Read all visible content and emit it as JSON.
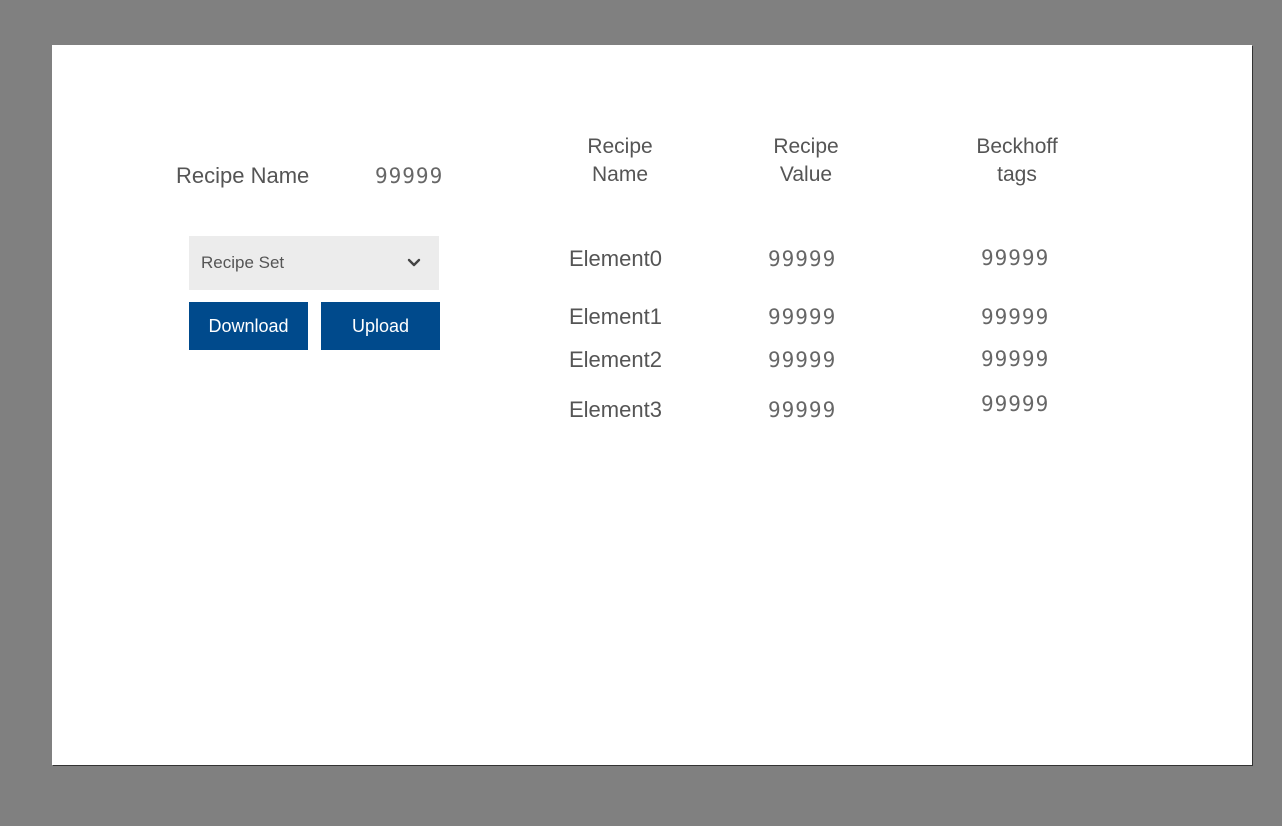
{
  "recipe_name": {
    "label": "Recipe Name",
    "value": "99999"
  },
  "recipe_set": {
    "selected": "Recipe Set"
  },
  "buttons": {
    "download": "Download",
    "upload": "Upload"
  },
  "table": {
    "headers": {
      "name": [
        "Recipe",
        "Name"
      ],
      "value": [
        "Recipe",
        "Value"
      ],
      "tags": [
        "Beckhoff",
        "tags"
      ]
    },
    "rows": [
      {
        "name": "Element0",
        "value": "99999",
        "tag": "99999"
      },
      {
        "name": "Element1",
        "value": "99999",
        "tag": "99999"
      },
      {
        "name": "Element2",
        "value": "99999",
        "tag": "99999"
      },
      {
        "name": "Element3",
        "value": "99999",
        "tag": "99999"
      }
    ]
  },
  "colors": {
    "background": "#808080",
    "panel": "#ffffff",
    "button": "#004a8c",
    "select_bg": "#ececec"
  }
}
